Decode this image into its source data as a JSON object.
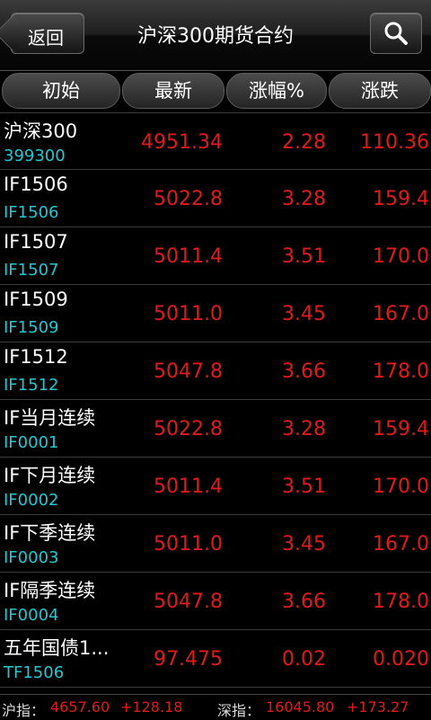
{
  "header": {
    "back_label": "返回",
    "title": "沪深300期货合约",
    "search_icon": "search-icon"
  },
  "columns": [
    "初始",
    "最新",
    "涨幅%",
    "涨跌"
  ],
  "rows": [
    {
      "name": "沪深300",
      "code": "399300",
      "price": "4951.34",
      "pct": "2.28",
      "chg": "110.36"
    },
    {
      "name": "IF1506",
      "code": "IF1506",
      "price": "5022.8",
      "pct": "3.28",
      "chg": "159.4"
    },
    {
      "name": "IF1507",
      "code": "IF1507",
      "price": "5011.4",
      "pct": "3.51",
      "chg": "170.0"
    },
    {
      "name": "IF1509",
      "code": "IF1509",
      "price": "5011.0",
      "pct": "3.45",
      "chg": "167.0"
    },
    {
      "name": "IF1512",
      "code": "IF1512",
      "price": "5047.8",
      "pct": "3.66",
      "chg": "178.0"
    },
    {
      "name": "IF当月连续",
      "code": "IF0001",
      "price": "5022.8",
      "pct": "3.28",
      "chg": "159.4"
    },
    {
      "name": "IF下月连续",
      "code": "IF0002",
      "price": "5011.4",
      "pct": "3.51",
      "chg": "170.0"
    },
    {
      "name": "IF下季连续",
      "code": "IF0003",
      "price": "5011.0",
      "pct": "3.45",
      "chg": "167.0"
    },
    {
      "name": "IF隔季连续",
      "code": "IF0004",
      "price": "5047.8",
      "pct": "3.66",
      "chg": "178.0"
    },
    {
      "name": "五年国债1...",
      "code": "TF1506",
      "price": "97.475",
      "pct": "0.02",
      "chg": "0.020"
    }
  ],
  "footer": {
    "sh_label": "沪指：",
    "sh_value": "4657.60",
    "sh_change": "+128.18",
    "sz_label": "深指：",
    "sz_value": "16045.80",
    "sz_change": "+173.27"
  },
  "colors": {
    "up": "#e01b1b",
    "code": "#22c8d4",
    "background": "#000000"
  }
}
